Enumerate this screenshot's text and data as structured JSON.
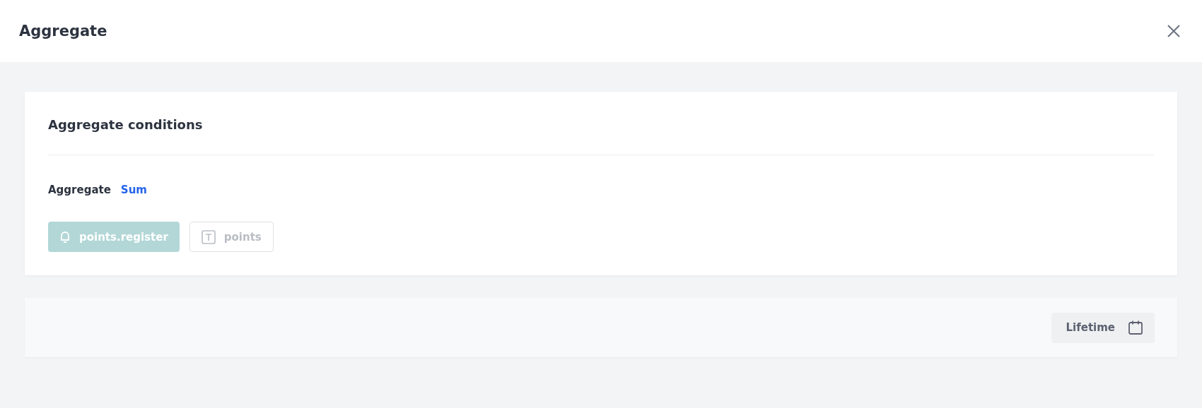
{
  "window": {
    "title": "Aggregate"
  },
  "conditions": {
    "title": "Aggregate conditions",
    "aggregate_label": "Aggregate",
    "aggregate_value": "Sum",
    "chips": [
      {
        "kind": "event",
        "label": "points.register"
      },
      {
        "kind": "text",
        "label": "points"
      }
    ]
  },
  "period": {
    "label": "Lifetime"
  }
}
